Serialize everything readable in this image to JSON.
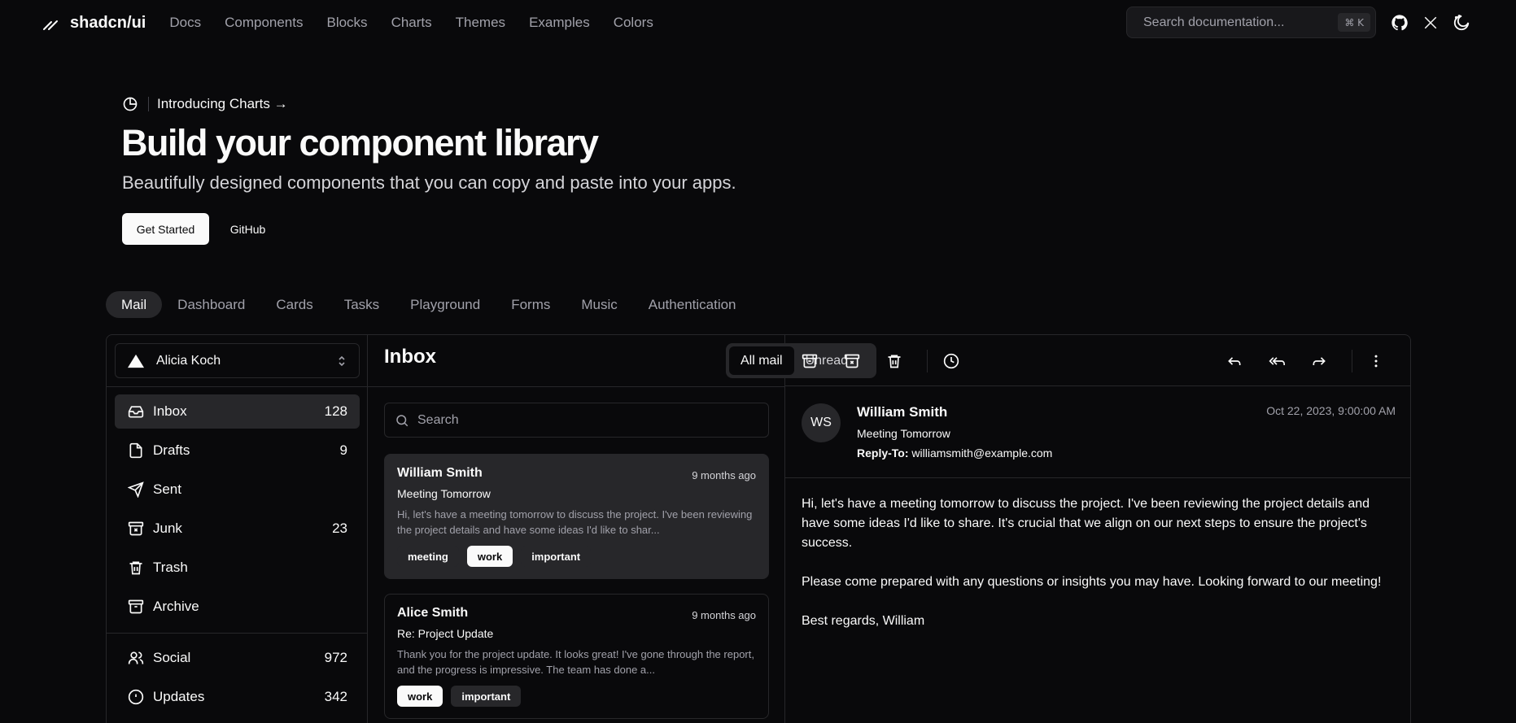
{
  "header": {
    "brand": "shadcn/ui",
    "nav": [
      "Docs",
      "Components",
      "Blocks",
      "Charts",
      "Themes",
      "Examples",
      "Colors"
    ],
    "search_placeholder": "Search documentation...",
    "search_shortcut": "⌘ K",
    "icons": [
      "github-icon",
      "x-icon",
      "theme-toggle-icon"
    ]
  },
  "hero": {
    "announcement": "Introducing Charts →",
    "title": "Build your component library",
    "subtitle": "Beautifully designed components that you can copy and paste into your apps.",
    "primary_button": "Get Started",
    "secondary_button": "GitHub"
  },
  "example_tabs": [
    "Mail",
    "Dashboard",
    "Cards",
    "Tasks",
    "Playground",
    "Forms",
    "Music",
    "Authentication"
  ],
  "mail": {
    "account": "Alicia Koch",
    "folders": [
      {
        "label": "Inbox",
        "count": "128",
        "icon": "inbox-icon"
      },
      {
        "label": "Drafts",
        "count": "9",
        "icon": "file-icon"
      },
      {
        "label": "Sent",
        "count": "",
        "icon": "send-icon"
      },
      {
        "label": "Junk",
        "count": "23",
        "icon": "archive-x-icon"
      },
      {
        "label": "Trash",
        "count": "",
        "icon": "trash-icon"
      },
      {
        "label": "Archive",
        "count": "",
        "icon": "archive-icon"
      }
    ],
    "categories": [
      {
        "label": "Social",
        "count": "972",
        "icon": "users-icon"
      },
      {
        "label": "Updates",
        "count": "342",
        "icon": "alert-circle-icon"
      }
    ],
    "list_title": "Inbox",
    "filter": {
      "all": "All mail",
      "unread": "Unread"
    },
    "search_placeholder": "Search",
    "messages": [
      {
        "name": "William Smith",
        "date": "9 months ago",
        "subject": "Meeting Tomorrow",
        "preview": "Hi, let's have a meeting tomorrow to discuss the project. I've been reviewing the project details and have some ideas I'd like to shar...",
        "tags": [
          "meeting",
          "work",
          "important"
        ]
      },
      {
        "name": "Alice Smith",
        "date": "9 months ago",
        "subject": "Re: Project Update",
        "preview": "Thank you for the project update. It looks great! I've gone through the report, and the progress is impressive. The team has done a...",
        "tags": [
          "work",
          "important"
        ]
      }
    ],
    "open": {
      "initials": "WS",
      "from": "William Smith",
      "subject": "Meeting Tomorrow",
      "reply_to_label": "Reply-To:",
      "reply_to": "williamsmith@example.com",
      "date": "Oct 22, 2023, 9:00:00 AM",
      "body": "Hi, let's have a meeting tomorrow to discuss the project. I've been reviewing the project details and have some ideas I'd like to share. It's crucial that we align on our next steps to ensure the project's success.\n\nPlease come prepared with any questions or insights you may have. Looking forward to our meeting!\n\nBest regards, William"
    }
  }
}
